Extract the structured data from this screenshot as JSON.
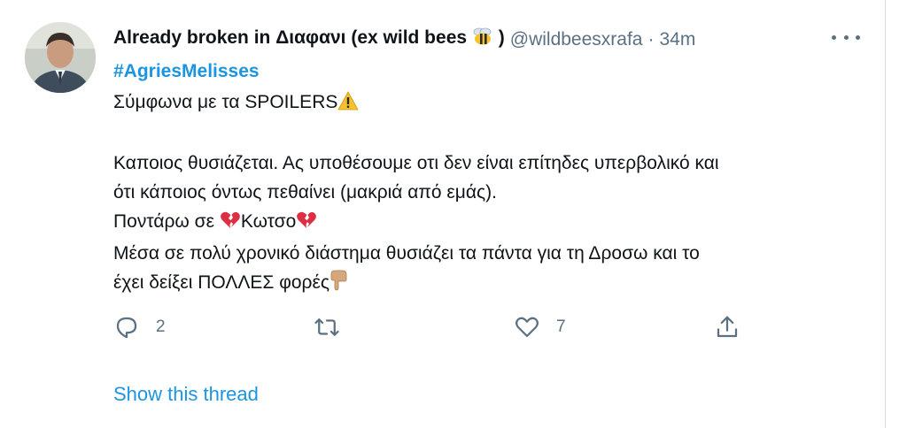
{
  "tweet": {
    "display_name": "Already broken in Διαφανι (ex wild bees",
    "display_name_suffix": ")",
    "handle": "@wildbeesxrafa",
    "separator": "·",
    "time": "34m",
    "hashtag": "#AgriesMelisses",
    "lines": [
      "Σύμφωνα με τα SPOILERS",
      "",
      "Καποιος θυσιάζεται. Ας υποθέσουμε οτι δεν είναι επίτηδες υπερβολικό και",
      "ότι κάποιος όντως πεθαίνει (μακριά από εμάς).",
      "Ποντάρω σε ",
      "Κωτσο",
      "Μέσα σε πολύ χρονικό διάστημα θυσιάζει τα πάντα για τη Δροσω και το",
      "έχει δείξει ΠΟΛΛΕΣ φορές"
    ],
    "emoji": {
      "name_suffix": "bee-icon",
      "spoilers": "warning-icon",
      "kotso": "broken-heart-icon",
      "end": "pointing-down-hand-icon"
    }
  },
  "actions": {
    "reply_count": "2",
    "retweet_count": "",
    "like_count": "7"
  },
  "show_thread_label": "Show this thread",
  "colors": {
    "accent": "#1b95e0",
    "secondary_text": "#5b7083",
    "primary_text": "#0f1419"
  }
}
